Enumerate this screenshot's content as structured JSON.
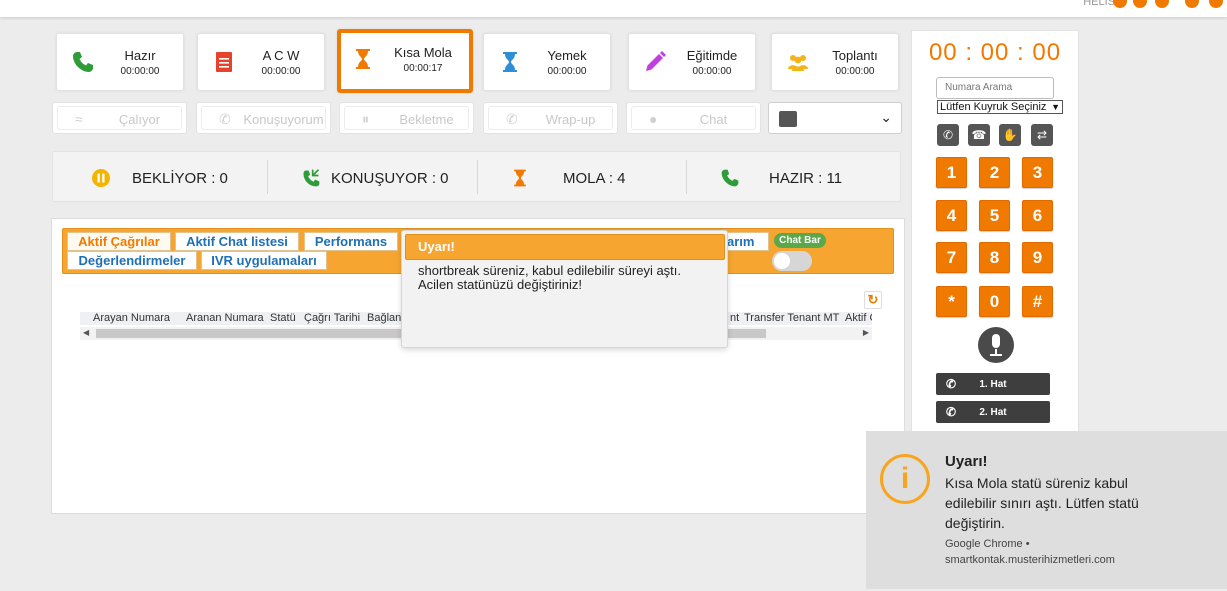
{
  "topbar": {
    "user_text": "HELIS"
  },
  "status_cards": [
    {
      "label": "Hazır",
      "time": "00:00:00",
      "icon": "phone-icon",
      "active": false
    },
    {
      "label": "A C W",
      "time": "00:00:00",
      "icon": "document-icon",
      "active": false
    },
    {
      "label": "Kısa Mola",
      "time": "00:00:17",
      "icon": "hourglass-icon",
      "active": true
    },
    {
      "label": "Yemek",
      "time": "00:00:00",
      "icon": "hourglass-icon",
      "active": false
    },
    {
      "label": "Eğitimde",
      "time": "00:00:00",
      "icon": "pencil-icon",
      "active": false
    },
    {
      "label": "Toplantı",
      "time": "00:00:00",
      "icon": "people-icon",
      "active": false
    }
  ],
  "call_buttons": [
    {
      "label": "Çalıyor",
      "icon": "wifi-icon"
    },
    {
      "label": "Konuşuyorum",
      "icon": "phone-incoming-icon"
    },
    {
      "label": "Bekletme",
      "icon": "pause-icon"
    },
    {
      "label": "Wrap-up",
      "icon": "phone-incoming-icon"
    },
    {
      "label": "Chat",
      "icon": "chat-icon"
    }
  ],
  "summary": {
    "waiting": "BEKLİYOR : 0",
    "talking": "KONUŞUYOR : 0",
    "break": "MOLA : 4",
    "ready": "HAZIR : 11"
  },
  "tabs": {
    "row1": [
      "Aktif Çağrılar",
      "Aktif Chat listesi",
      "Performans",
      "arım"
    ],
    "row2": [
      "Değerlendirmeler",
      "IVR uygulamaları"
    ],
    "chat_bar": "Chat Bar"
  },
  "grid_columns": [
    "Arayan Numara",
    "Aranan Numara",
    "Statü",
    "Çağrı Tarihi",
    "Bağlan",
    "nt",
    "Transfer Tenant MT",
    "Aktif Ç"
  ],
  "modal": {
    "title": "Uyarı!",
    "line1": "shortbreak süreniz, kabul edilebilir süreyi aştı.",
    "line2": "Acilen statünüzü değiştiriniz!"
  },
  "right_panel": {
    "timer": "00 : 00 : 00",
    "search_placeholder": "Numara Arama",
    "queue_select": "Lütfen Kuyruk Seçiniz",
    "keys": [
      "1",
      "2",
      "3",
      "4",
      "5",
      "6",
      "7",
      "8",
      "9",
      "*",
      "0",
      "#"
    ],
    "lines": [
      "1. Hat",
      "2. Hat"
    ]
  },
  "notification": {
    "title": "Uyarı!",
    "body": "Kısa Mola statü süreniz kabul edilebilir sınırı aştı. Lütfen statü değiştirin.",
    "source1": "Google Chrome •",
    "source2": "smartkontak.musterihizmetleri.com"
  },
  "colors": {
    "accent": "#f07a00",
    "tab_bar": "#f6a531",
    "tab_text": "#1f6fb5"
  }
}
